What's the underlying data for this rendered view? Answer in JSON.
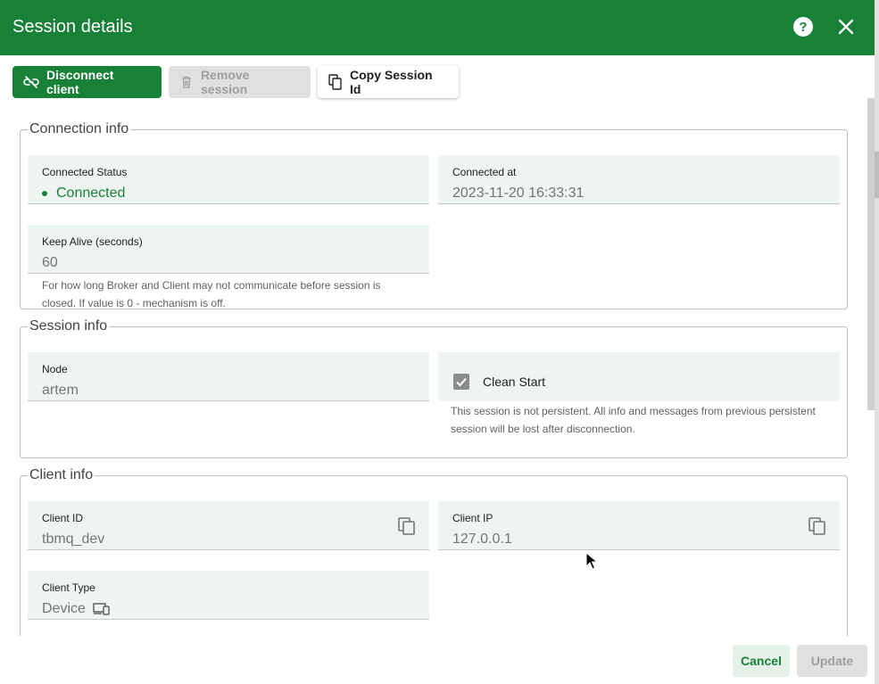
{
  "header": {
    "title": "Session details",
    "help_icon": "help-icon",
    "close_icon": "close-icon"
  },
  "toolbar": {
    "disconnect_label": "Disconnect client",
    "remove_label": "Remove session",
    "copy_label": "Copy Session Id"
  },
  "connection_info": {
    "legend": "Connection info",
    "status_label": "Connected Status",
    "status_value": "Connected",
    "connected_at_label": "Connected at",
    "connected_at_value": "2023-11-20 16:33:31",
    "keep_alive_label": "Keep Alive (seconds)",
    "keep_alive_value": "60",
    "keep_alive_hint": "For how long Broker and Client may not communicate before session is closed. If value is 0 - mechanism is off."
  },
  "session_info": {
    "legend": "Session info",
    "node_label": "Node",
    "node_value": "artem",
    "clean_start_label": "Clean Start",
    "clean_start_checked": true,
    "clean_start_hint": "This session is not persistent. All info and messages from previous persistent session will be lost after disconnection."
  },
  "client_info": {
    "legend": "Client info",
    "client_id_label": "Client ID",
    "client_id_value": "tbmq_dev",
    "client_ip_label": "Client IP",
    "client_ip_value": "127.0.0.1",
    "client_type_label": "Client Type",
    "client_type_value": "Device"
  },
  "footer": {
    "cancel_label": "Cancel",
    "update_label": "Update"
  },
  "colors": {
    "primary": "#198038",
    "field_bg": "#eef5f0",
    "disabled": "#e0e0e0"
  }
}
